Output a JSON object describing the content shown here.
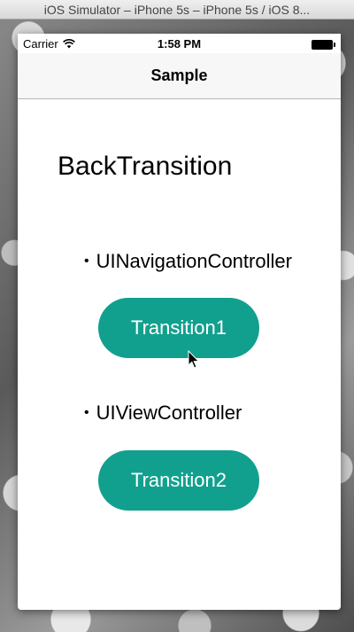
{
  "window": {
    "title": "iOS Simulator – iPhone 5s – iPhone 5s / iOS 8..."
  },
  "status_bar": {
    "carrier": "Carrier",
    "time": "1:58 PM",
    "wifi_icon": "wifi-icon",
    "battery_icon": "battery-icon"
  },
  "nav_bar": {
    "title": "Sample"
  },
  "content": {
    "heading": "BackTransition",
    "bullet_symbol": "•",
    "sections": [
      {
        "label": "UINavigationController",
        "button_label": "Transition1"
      },
      {
        "label": "UIViewController",
        "button_label": "Transition2"
      }
    ]
  },
  "colors": {
    "button_background": "#12a08e",
    "button_text": "#ffffff"
  }
}
